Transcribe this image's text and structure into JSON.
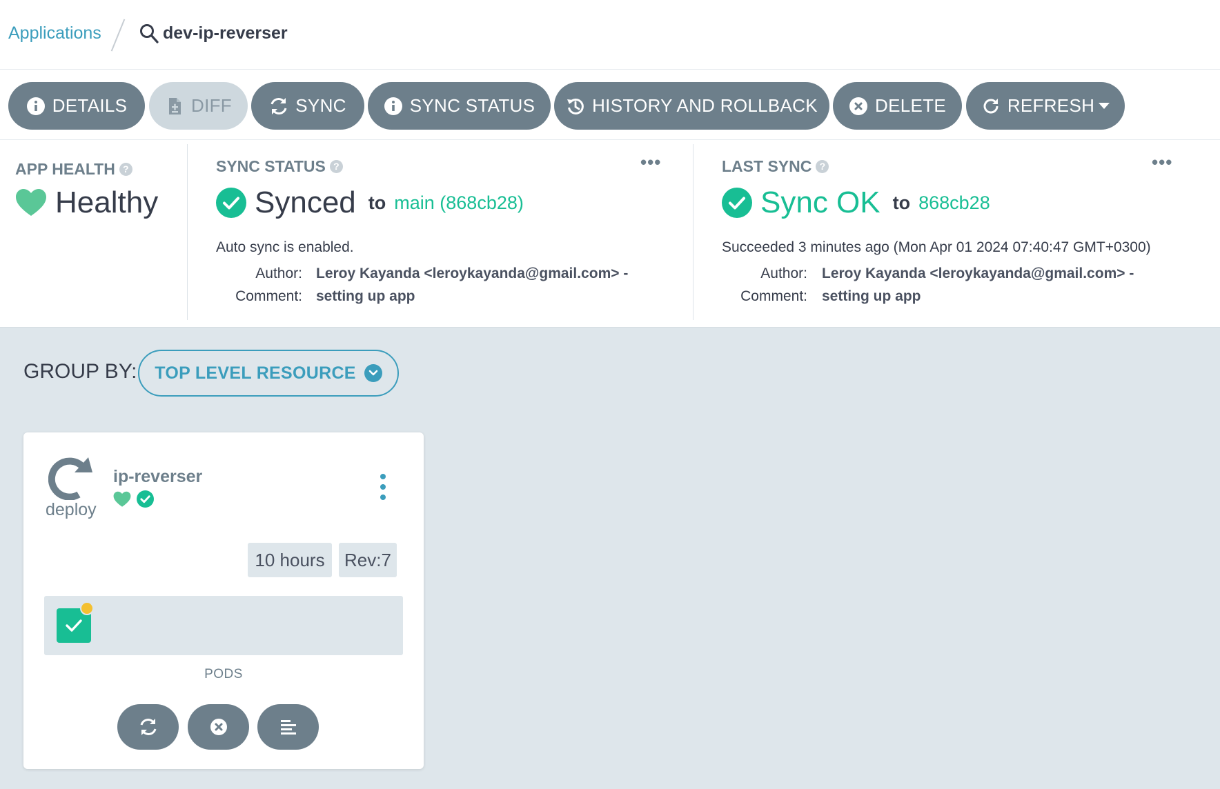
{
  "breadcrumb": {
    "root_label": "Applications",
    "current_label": "dev-ip-reverser"
  },
  "toolbar": {
    "details_label": "DETAILS",
    "diff_label": "DIFF",
    "sync_label": "SYNC",
    "sync_status_label": "SYNC STATUS",
    "history_label": "HISTORY AND ROLLBACK",
    "delete_label": "DELETE",
    "refresh_label": "REFRESH"
  },
  "app_health": {
    "label": "APP HEALTH",
    "value": "Healthy",
    "color": "#5ac797"
  },
  "sync_status": {
    "label": "SYNC STATUS",
    "value": "Synced",
    "to_label": "to",
    "target": "main (868cb28)",
    "auto_sync": "Auto sync is enabled.",
    "author_key": "Author:",
    "author_value": "Leroy Kayanda <leroykayanda@gmail.com> -",
    "comment_key": "Comment:",
    "comment_value": "setting up app"
  },
  "last_sync": {
    "label": "LAST SYNC",
    "value": "Sync OK",
    "to_label": "to",
    "target": "868cb28",
    "result": "Succeeded 3 minutes ago (Mon Apr 01 2024 07:40:47 GMT+0300)",
    "author_key": "Author:",
    "author_value": "Leroy Kayanda <leroykayanda@gmail.com> -",
    "comment_key": "Comment:",
    "comment_value": "setting up app"
  },
  "group_by": {
    "label": "GROUP BY:",
    "value": "TOP LEVEL RESOURCE"
  },
  "resource": {
    "kind": "deploy",
    "name": "ip-reverser",
    "age": "10 hours",
    "revision": "Rev:7",
    "pods_label": "PODS",
    "pod_status": "healthy",
    "pod_indicator_color": "#f4c030"
  },
  "colors": {
    "accent": "#3b9dbc",
    "success": "#18be94",
    "button": "#6d7f8b",
    "background": "#dee6eb"
  }
}
